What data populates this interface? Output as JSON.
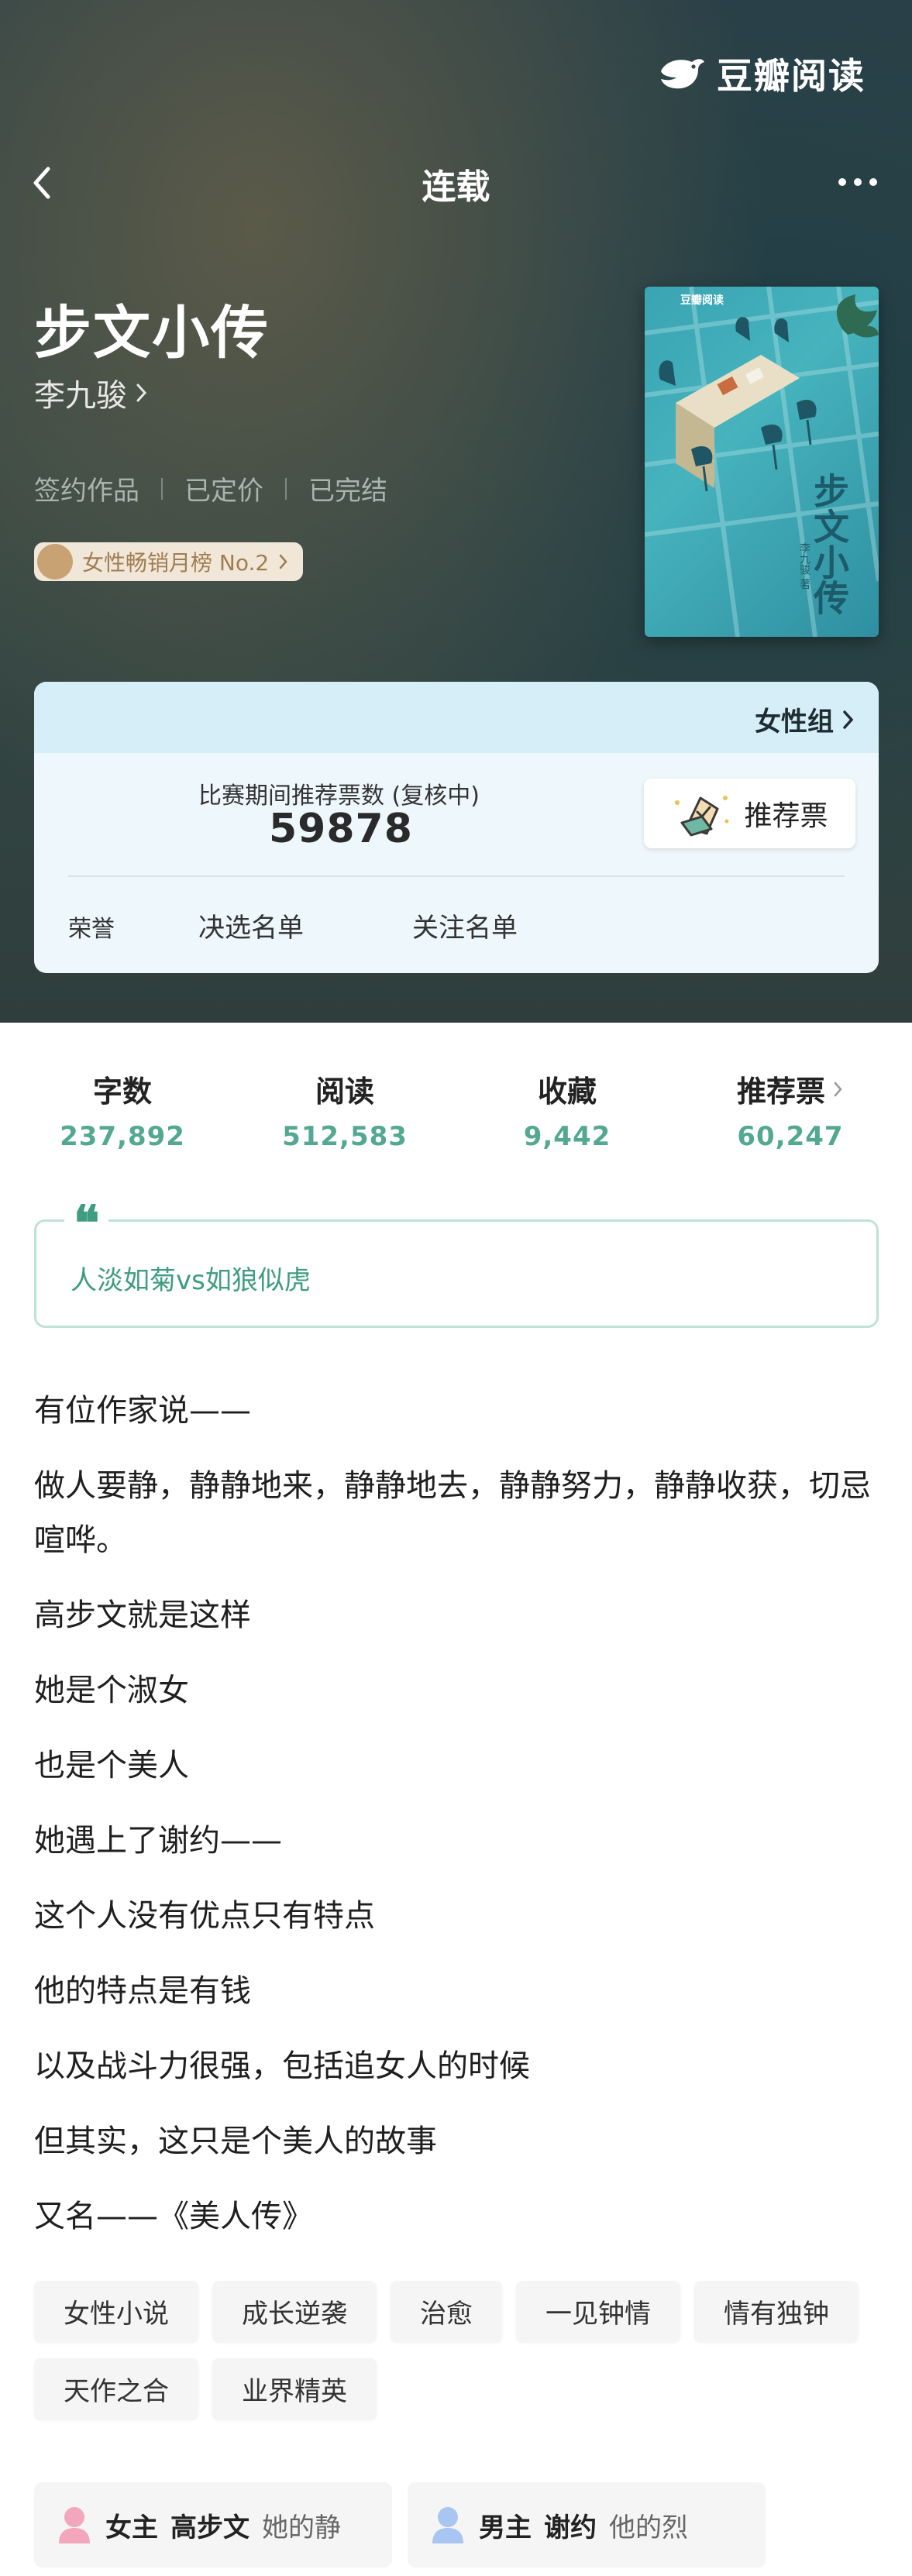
{
  "brand": {
    "name": "豆瓣阅读"
  },
  "nav": {
    "title": "连载"
  },
  "book": {
    "title": "步文小传",
    "author": "李九骏",
    "meta": [
      "签约作品",
      "已定价",
      "已完结"
    ],
    "rank_badge": "女性畅销月榜 No.2",
    "cover": {
      "brand": "豆瓣阅读",
      "title": "步文小传",
      "author": "李九骏 著"
    }
  },
  "contest": {
    "group": "女性组",
    "vote_label": "比赛期间推荐票数 (复核中)",
    "vote_count": "59878",
    "vote_button": "推荐票",
    "honor_label": "荣誉",
    "honors": [
      "决选名单",
      "关注名单"
    ]
  },
  "stats": [
    {
      "label": "字数",
      "value": "237,892"
    },
    {
      "label": "阅读",
      "value": "512,583"
    },
    {
      "label": "收藏",
      "value": "9,442"
    },
    {
      "label": "推荐票",
      "value": "60,247"
    }
  ],
  "quote": {
    "mark": "❝",
    "text": "人淡如菊vs如狼似虎"
  },
  "intro": [
    "有位作家说——",
    "做人要静，静静地来，静静地去，静静努力，静静收获，切忌喧哗。",
    "高步文就是这样",
    "她是个淑女",
    "也是个美人",
    "她遇上了谢约——",
    "这个人没有优点只有特点",
    "他的特点是有钱",
    "以及战斗力很强，包括追女人的时候",
    "但其实，这只是个美人的故事",
    "又名——《美人传》"
  ],
  "tags": [
    "女性小说",
    "成长逆袭",
    "治愈",
    "一见钟情",
    "情有独钟",
    "天作之合",
    "业界精英"
  ],
  "characters": [
    {
      "role": "女主",
      "name": "高步文",
      "desc": "她的静",
      "icon": "female-avatar-icon",
      "color": "#f2a7bd"
    },
    {
      "role": "男主",
      "name": "谢约",
      "desc": "他的烈",
      "icon": "male-avatar-icon",
      "color": "#a9c5f2"
    }
  ],
  "colors": {
    "accent": "#52a890",
    "quote": "#3f9c80",
    "card": "#eef7fb",
    "card_head": "#d5eef8"
  }
}
